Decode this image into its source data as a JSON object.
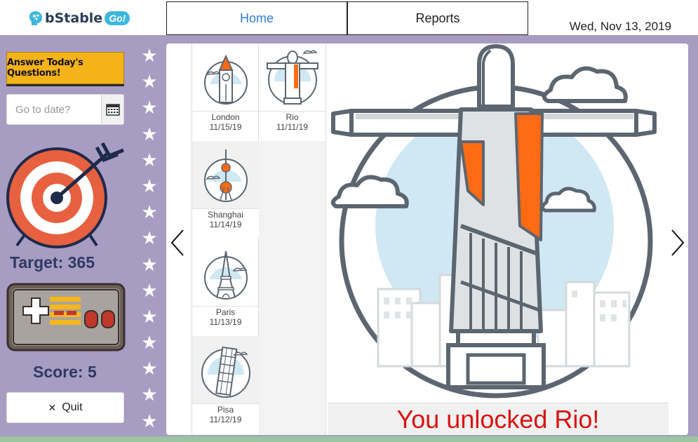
{
  "header": {
    "logo_brand": "bStable",
    "logo_badge": "Go!",
    "tabs": [
      {
        "label": "Home",
        "active": true
      },
      {
        "label": "Reports",
        "active": false
      }
    ],
    "date": "Wed, Nov 13, 2019"
  },
  "sidebar": {
    "answer_button": "Answer Today's Questions!",
    "goto_placeholder": "Go to date?",
    "target_label": "Target: 365",
    "score_label": "Score: 5",
    "quit_label": "Quit",
    "star_count": 15
  },
  "gallery": {
    "thumbnails": [
      {
        "city": "London",
        "date": "11/15/19"
      },
      {
        "city": "Rio",
        "date": "11/11/19"
      },
      {
        "city": "Shanghai",
        "date": "11/14/19"
      },
      {
        "city": "Paris",
        "date": "11/13/19"
      },
      {
        "city": "Pisa",
        "date": "11/12/19"
      }
    ],
    "unlock_message": "You unlocked Rio!"
  },
  "colors": {
    "sidebar": "#a79cc2",
    "accent_orange": "#ff6a13",
    "sky_blue": "#cfe8f3",
    "outline": "#5c6670",
    "unlock_red": "#d11111",
    "button_yellow": "#f5b31a"
  }
}
